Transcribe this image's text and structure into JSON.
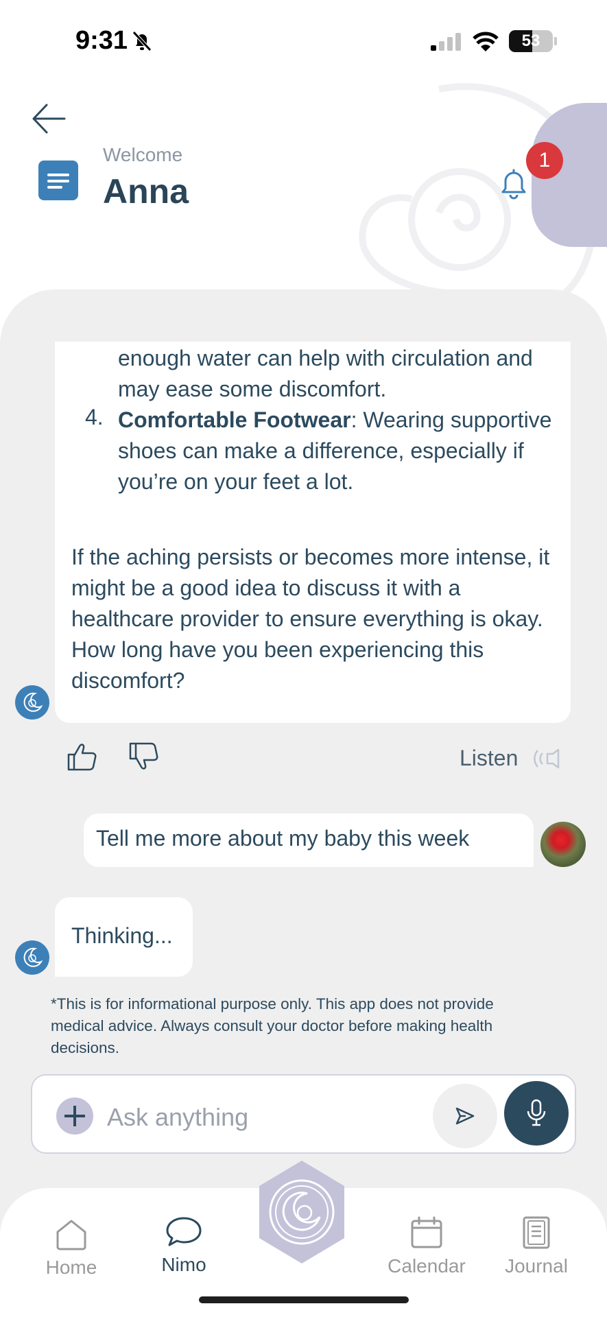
{
  "status_bar": {
    "time": "9:31",
    "battery": "53",
    "battery_level": 0.53
  },
  "header": {
    "welcome_label": "Welcome",
    "user_name": "Anna",
    "notification_count": "1"
  },
  "chat": {
    "bot_message_1": {
      "item3_continuation": "enough water can help with circulation and may ease some discomfort.",
      "item4_number": "4.",
      "item4_title": "Comfortable Footwear",
      "item4_body": ": Wearing supportive shoes can make a difference, especially if you’re on your feet a lot.",
      "paragraph": "If the aching persists or becomes more intense, it might be a good idea to discuss it with a healthcare provider to ensure everything is okay. How long have you been experiencing this discomfort?"
    },
    "listen_label": "Listen",
    "user_message": "Tell me more about my baby this week",
    "bot_message_2": "Thinking...",
    "disclaimer": "*This is for informational purpose only. This app does not provide medical advice. Always consult your doctor before making health decisions."
  },
  "input": {
    "placeholder": "Ask anything",
    "value": ""
  },
  "nav": {
    "home": "Home",
    "nimo": "Nimo",
    "calendar": "Calendar",
    "journal": "Journal"
  },
  "colors": {
    "primary": "#2c4a5e",
    "accent_blue": "#3d80b8",
    "lavender": "#c4c2d9",
    "badge_red": "#d9383c",
    "panel_bg": "#efefef"
  }
}
